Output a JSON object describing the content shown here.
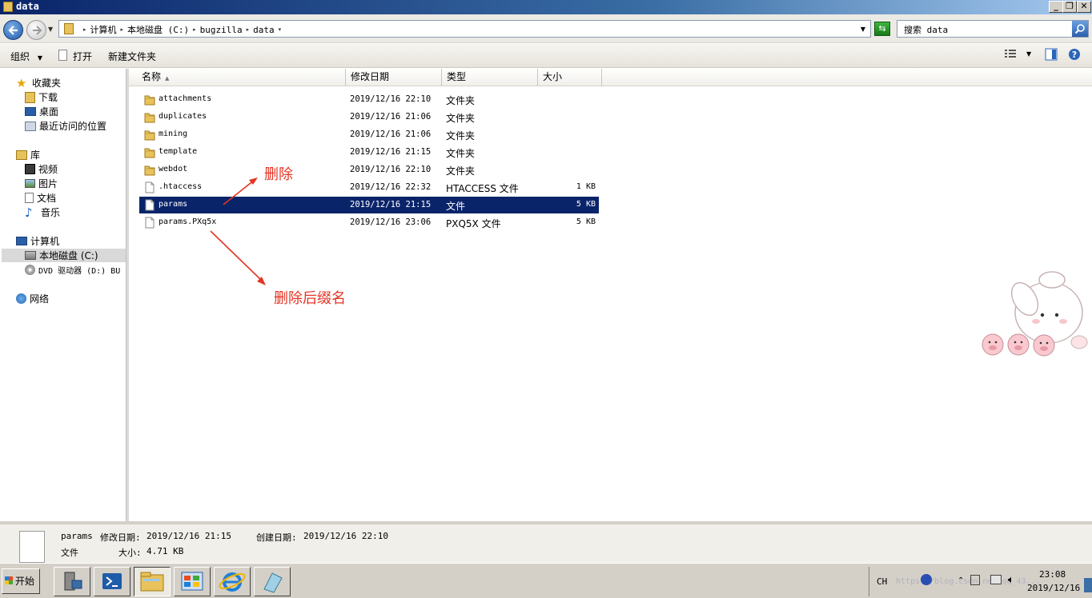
{
  "window": {
    "title": "data"
  },
  "address": {
    "crumbs": [
      "计算机",
      "本地磁盘 (C:)",
      "bugzilla",
      "data"
    ]
  },
  "search": {
    "placeholder": "搜索 data"
  },
  "toolbar": {
    "organize": "组织",
    "open": "打开",
    "new_folder": "新建文件夹"
  },
  "sidebar": {
    "favorites": "收藏夹",
    "downloads": "下载",
    "desktop": "桌面",
    "recent": "最近访问的位置",
    "libraries": "库",
    "videos": "视频",
    "pictures": "图片",
    "documents": "文档",
    "music": "音乐",
    "computer": "计算机",
    "local_disk": "本地磁盘 (C:)",
    "dvd": "DVD 驱动器 (D:) BU",
    "network": "网络"
  },
  "columns": {
    "name": "名称",
    "date": "修改日期",
    "type": "类型",
    "size": "大小"
  },
  "files": [
    {
      "name": "attachments",
      "date": "2019/12/16 22:10",
      "type": "文件夹",
      "size": "",
      "icon": "folder-icon"
    },
    {
      "name": "duplicates",
      "date": "2019/12/16 21:06",
      "type": "文件夹",
      "size": "",
      "icon": "folder-icon"
    },
    {
      "name": "mining",
      "date": "2019/12/16 21:06",
      "type": "文件夹",
      "size": "",
      "icon": "folder-icon"
    },
    {
      "name": "template",
      "date": "2019/12/16 21:15",
      "type": "文件夹",
      "size": "",
      "icon": "folder-icon"
    },
    {
      "name": "webdot",
      "date": "2019/12/16 22:10",
      "type": "文件夹",
      "size": "",
      "icon": "folder-icon"
    },
    {
      "name": ".htaccess",
      "date": "2019/12/16 22:32",
      "type": "HTACCESS 文件",
      "size": "1 KB",
      "icon": "file-icon"
    },
    {
      "name": "params",
      "date": "2019/12/16 21:15",
      "type": "文件",
      "size": "5 KB",
      "icon": "file-icon",
      "selected": true
    },
    {
      "name": "params.PXq5x",
      "date": "2019/12/16 23:06",
      "type": "PXQ5X 文件",
      "size": "5 KB",
      "icon": "file-icon"
    }
  ],
  "annotations": {
    "delete": "删除",
    "delete_suffix": "删除后缀名"
  },
  "details": {
    "name": "params",
    "modified_label": "修改日期:",
    "modified": "2019/12/16 21:15",
    "created_label": "创建日期:",
    "created": "2019/12/16 22:10",
    "type": "文件",
    "size_label": "大小:",
    "size": "4.71 KB"
  },
  "taskbar": {
    "start": "开始",
    "lang": "CH",
    "time": "23:08",
    "date": "2019/12/16",
    "watermark": "https://blog.csdn.net/qq_43..."
  },
  "colors": {
    "selection": "#0a246a",
    "annotation": "#e53424"
  }
}
